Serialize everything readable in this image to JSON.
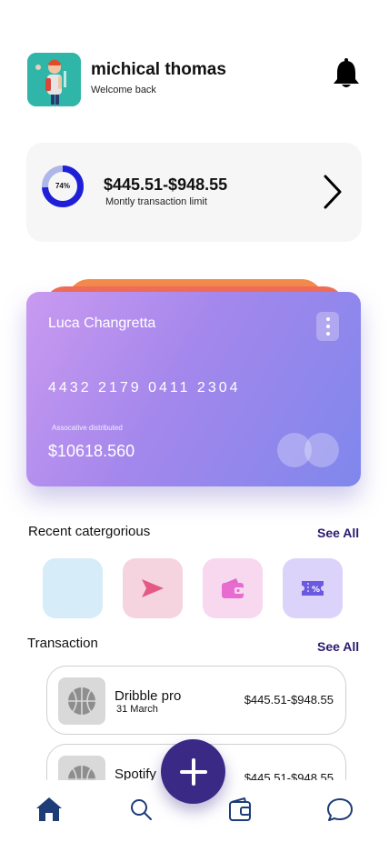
{
  "header": {
    "user_name": "michical thomas",
    "subtitle": "Welcome back",
    "avatar": "avatar-illustration",
    "notification_icon": "bell-icon"
  },
  "limit": {
    "percent_label": "74%",
    "percent": 74,
    "amount": "$445.51-$948.55",
    "label": "Montly transaction limit",
    "accent": "#1f1fd8"
  },
  "card": {
    "holder": "Luca Changretta",
    "number": "4432 2179 0411 2304",
    "balance_label": "Assocative distributed",
    "balance": "$10618.560",
    "gradient": [
      "#c99af0",
      "#7f87ec"
    ],
    "back_colors": [
      "#f48a4a",
      "#f26c55"
    ]
  },
  "categories": {
    "title": "Recent catergorious",
    "see_all": "See All",
    "items": [
      {
        "icon": "blank-icon",
        "color": "#d6ecf8"
      },
      {
        "icon": "send-icon",
        "color": "#f6d4df"
      },
      {
        "icon": "wallet-icon",
        "color": "#f8d8ef"
      },
      {
        "icon": "ticket-icon",
        "color": "#dcd3fb"
      }
    ]
  },
  "transactions": {
    "title": "Transaction",
    "see_all": "See All",
    "items": [
      {
        "title": "Dribble pro",
        "date": "31 March",
        "amount": "$445.51-$948.55",
        "icon": "basketball-icon"
      },
      {
        "title": "Spotify",
        "date": "",
        "amount": "$445.51-$948.55",
        "icon": "basketball-icon"
      }
    ]
  },
  "nav": {
    "items": [
      "home-icon",
      "search-icon",
      "wallet-icon",
      "chat-icon"
    ],
    "fab": "plus-icon",
    "active_color": "#1d3c78",
    "fab_color": "#3a2a86"
  }
}
